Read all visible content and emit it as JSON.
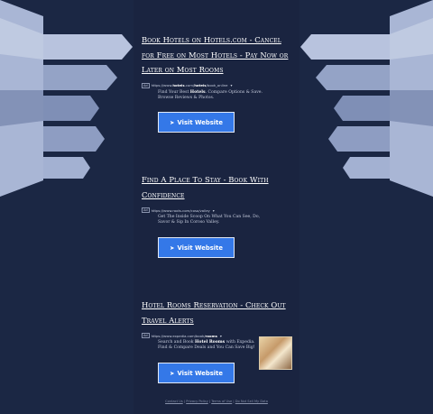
{
  "colors": {
    "background": "#1b2744",
    "button": "#3478e8",
    "title_text": "#ffffff"
  },
  "results": [
    {
      "title": "Book Hotels on Hotels.com - Cancel for Free on Most Hotels - Pay Now or Later on Most Rooms",
      "ad_label": "Ad",
      "url_prefix": "https://www.",
      "url_bold": "hotels",
      "url_mid": ".com/",
      "url_bold2": "hotels",
      "url_suffix": "/book_online",
      "desc_before": "Find Your Best ",
      "desc_bold": "Hotels",
      "desc_after": ". Compare Options & Save. Browse Reviews & Photos.",
      "button_label": "Visit Website",
      "button_icon": "arrow-icon"
    },
    {
      "title": "Find A Place To Stay - Book With Confidence",
      "ad_label": "Ad",
      "url": "https://www.roots.com/coso/valley",
      "desc": "Get The Inside Scoop On What You Can See, Do, Savor & Sip In Coroso Valley.",
      "button_label": "Visit Website",
      "button_icon": "arrow-icon"
    },
    {
      "title": "Hotel Rooms Reservation - Check Out Travel Alerts",
      "ad_label": "Ad",
      "url_prefix": "https://www.expedia.com/book/",
      "url_bold": "rooms",
      "desc_before": "Search and Book ",
      "desc_bold": "Hotel Rooms",
      "desc_after": " with Expedia. Find & Compare Deals and You Can Save Big!",
      "button_label": "Visit Website",
      "button_icon": "arrow-icon"
    }
  ],
  "footer": {
    "links": [
      "Contact Us",
      "Privacy Policy",
      "Terms of Use",
      "Do Not Sell My Data"
    ],
    "separator": " | "
  }
}
